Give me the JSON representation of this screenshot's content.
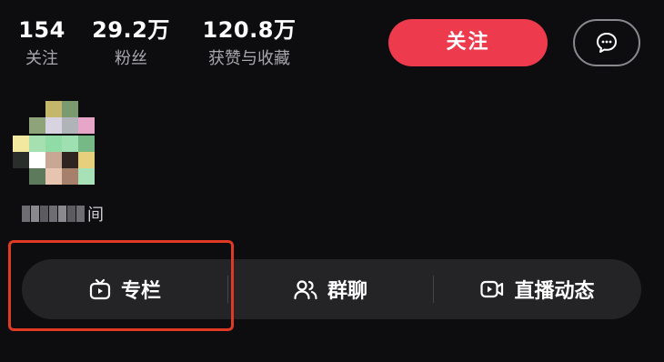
{
  "stats": {
    "following": {
      "value": "154",
      "label": "关注"
    },
    "fans": {
      "value": "29.2万",
      "label": "粉丝"
    },
    "likes": {
      "value": "120.8万",
      "label": "获赞与收藏"
    }
  },
  "actions": {
    "follow_label": "关注",
    "message_icon": "chat-bubble-icon"
  },
  "profile": {
    "username_visible_tail": "间"
  },
  "tabs": [
    {
      "label": "专栏",
      "icon": "tv-icon"
    },
    {
      "label": "群聊",
      "icon": "people-icon"
    },
    {
      "label": "直播动态",
      "icon": "video-camera-icon"
    }
  ],
  "colors": {
    "background": "#0d0d0f",
    "follow_button": "#ee3a4d",
    "tabbar": "#242427",
    "highlight_box": "#e13a24"
  }
}
